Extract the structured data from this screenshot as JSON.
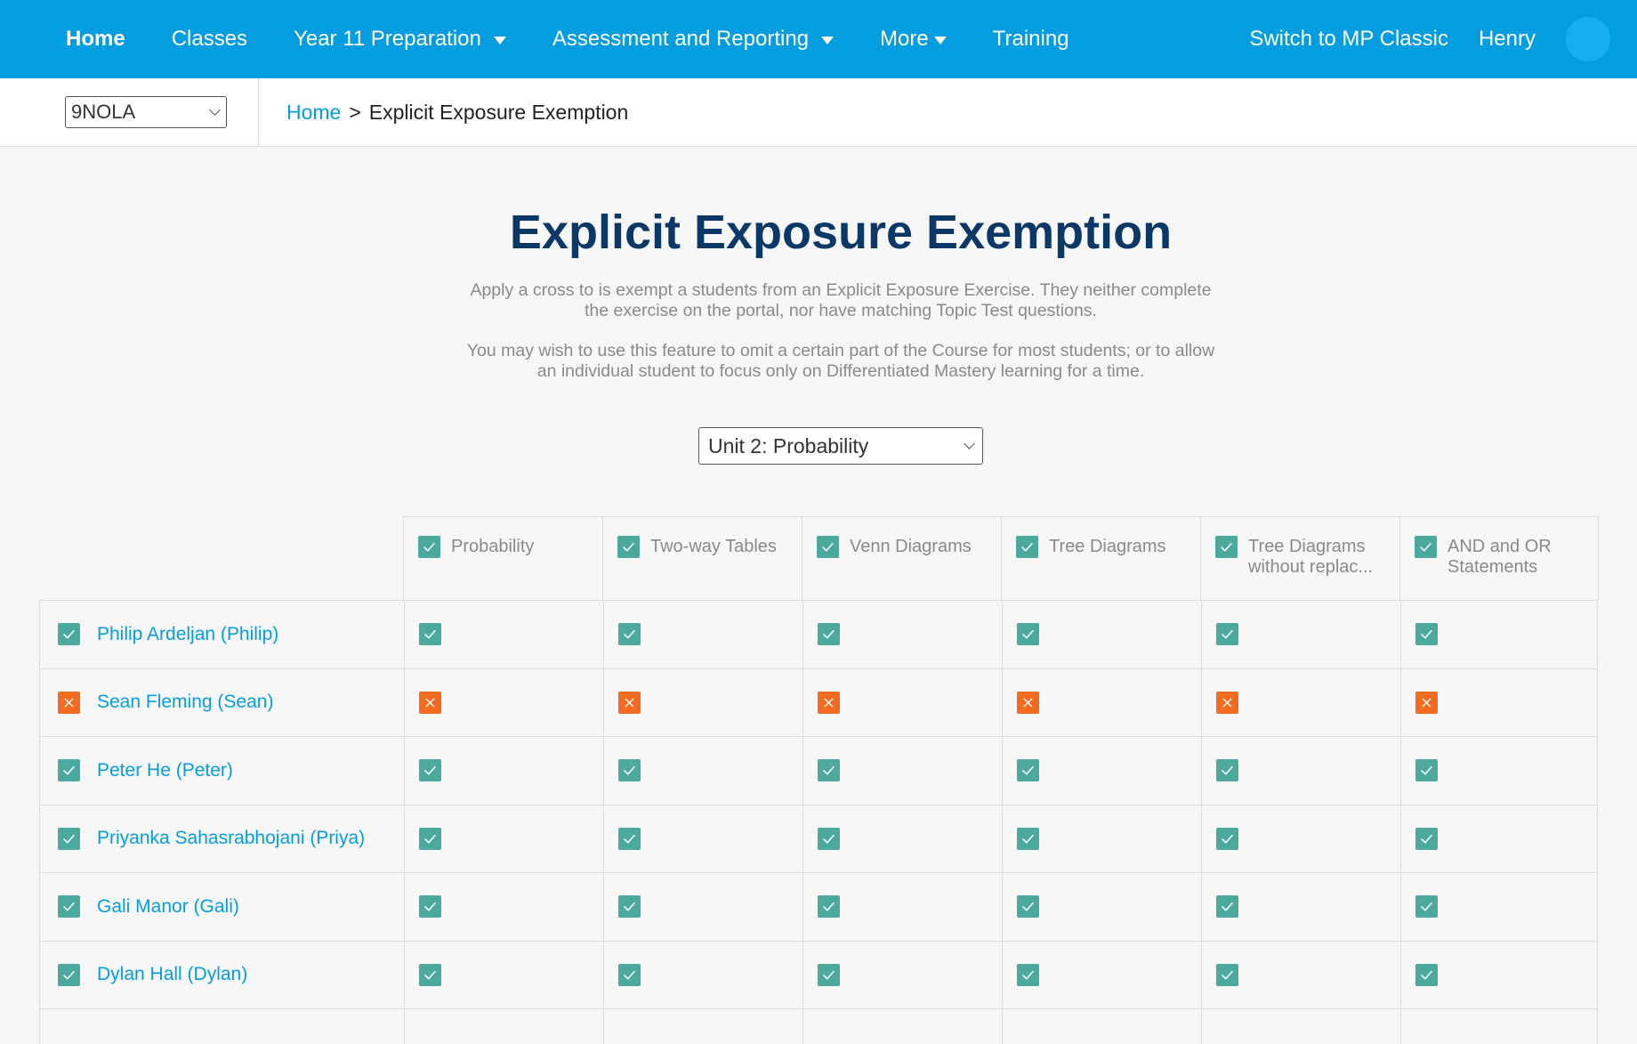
{
  "nav": {
    "items": [
      {
        "label": "Home",
        "active": true,
        "dropdown": false
      },
      {
        "label": "Classes",
        "active": false,
        "dropdown": false
      },
      {
        "label": "Year 11 Preparation",
        "active": false,
        "dropdown": true
      },
      {
        "label": "Assessment and Reporting",
        "active": false,
        "dropdown": true
      },
      {
        "label": "More",
        "active": false,
        "dropdown": true
      },
      {
        "label": "Training",
        "active": false,
        "dropdown": false
      }
    ],
    "switch_label": "Switch to MP Classic",
    "user_name": "Henry"
  },
  "class_select": {
    "value": "9NOLA"
  },
  "breadcrumb": {
    "home": "Home",
    "separator": ">",
    "current": "Explicit Exposure Exemption"
  },
  "page": {
    "title": "Explicit Exposure Exemption",
    "desc1_line1": "Apply a cross to is exempt a students from an Explicit Exposure Exercise. They neither complete",
    "desc1_line2": "the exercise on the portal, nor have matching Topic Test questions.",
    "desc2_line1": "You may wish to use this feature to omit a certain part of the Course for most students; or to allow",
    "desc2_line2": "an individual student to focus only on Differentiated Mastery learning for a time."
  },
  "unit_select": {
    "value": "Unit 2: Probability"
  },
  "table": {
    "columns": [
      {
        "line1": "Probability",
        "line2": "",
        "checked": true
      },
      {
        "line1": "Two-way Tables",
        "line2": "",
        "checked": true
      },
      {
        "line1": "Venn Diagrams",
        "line2": "",
        "checked": true
      },
      {
        "line1": "Tree Diagrams",
        "line2": "",
        "checked": true
      },
      {
        "line1": "Tree Diagrams",
        "line2": "without replac...",
        "checked": true
      },
      {
        "line1": "AND and OR",
        "line2": "Statements",
        "checked": true
      }
    ],
    "students": [
      {
        "name": "Philip Ardeljan (Philip)",
        "included": true,
        "cells": [
          true,
          true,
          true,
          true,
          true,
          true
        ]
      },
      {
        "name": "Sean Fleming (Sean)",
        "included": false,
        "cells": [
          false,
          false,
          false,
          false,
          false,
          false
        ]
      },
      {
        "name": "Peter He (Peter)",
        "included": true,
        "cells": [
          true,
          true,
          true,
          true,
          true,
          true
        ]
      },
      {
        "name": "Priyanka Sahasrabhojani (Priya)",
        "included": true,
        "cells": [
          true,
          true,
          true,
          true,
          true,
          true
        ]
      },
      {
        "name": "Gali Manor (Gali)",
        "included": true,
        "cells": [
          true,
          true,
          true,
          true,
          true,
          true
        ]
      },
      {
        "name": "Dylan Hall (Dylan)",
        "included": true,
        "cells": [
          true,
          true,
          true,
          true,
          true,
          true
        ]
      }
    ]
  },
  "colors": {
    "nav_bg": "#049ee0",
    "title": "#0c3868",
    "link": "#049ee0",
    "check_on": "#4ba99d",
    "check_off": "#f26b21"
  },
  "icons": {
    "checked": "check-icon",
    "exempt": "cross-icon",
    "dropdown": "chevron-down-icon"
  }
}
